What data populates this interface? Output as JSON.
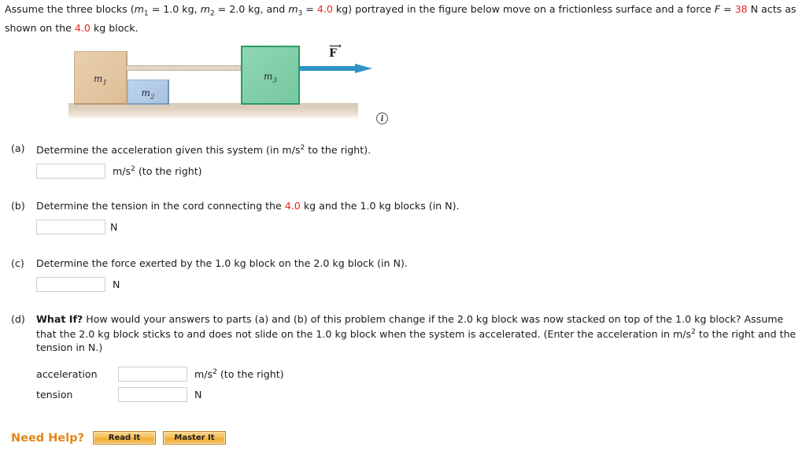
{
  "prompt": {
    "seg1": "Assume the three blocks (",
    "m1_sym": "m",
    "m1_sub": "1",
    "m1_eq": " = 1.0 kg, ",
    "m2_sym": "m",
    "m2_sub": "2",
    "m2_eq": " = 2.0 kg, and ",
    "m3_sym": "m",
    "m3_sub": "3",
    "m3_eq": " = ",
    "m3_val": "4.0",
    "seg2": " kg) portrayed in the figure below move on a frictionless surface and a force ",
    "f_sym": "F",
    "f_eq": " = ",
    "f_val": "38",
    "seg3": " N acts as shown on the ",
    "block_val": "4.0",
    "seg4": " kg block."
  },
  "figure": {
    "block_m1_label": "m",
    "block_m1_sub": "1",
    "block_m2_label": "m",
    "block_m2_sub": "2",
    "block_m3_label": "m",
    "block_m3_sub": "3",
    "force_label": "F",
    "force_vector_bar": "⟶",
    "info_icon_glyph": "i",
    "colors": {
      "block_m1": "#e3c6a2",
      "block_m2": "#b2cbe6",
      "block_m3": "#81ceaa",
      "block_m3_border": "#2a9b63",
      "arrow": "#2f93c8",
      "ground": "#ded0bd",
      "cord": "#cdbba4"
    }
  },
  "parts": {
    "a": {
      "tag": "(a)",
      "text_pre": "Determine the acceleration given this system (in m/s",
      "text_sup": "2",
      "text_post": " to the right).",
      "input_value": "",
      "input_placeholder": "",
      "unit_pre": "m/s",
      "unit_sup": "2",
      "unit_post": " (to the right)"
    },
    "b": {
      "tag": "(b)",
      "text_pre": "Determine the tension in the cord connecting the ",
      "text_red": "4.0",
      "text_post": " kg and the 1.0 kg blocks (in N).",
      "input_value": "",
      "input_placeholder": "",
      "unit": "N"
    },
    "c": {
      "tag": "(c)",
      "text": "Determine the force exerted by the 1.0 kg block on the 2.0 kg block (in N).",
      "input_value": "",
      "input_placeholder": "",
      "unit": "N"
    },
    "d": {
      "tag": "(d)",
      "what_if": "What If?",
      "text_pre": " How would your answers to parts (a) and (b) of this problem change if the 2.0 kg block was now stacked on top of the 1.0 kg block? Assume that the 2.0 kg block sticks to and does not slide on the 1.0 kg block when the system is accelerated. (Enter the acceleration in m/s",
      "text_sup": "2",
      "text_post": " to the right and the tension in N.)",
      "acceleration_label": "acceleration",
      "acceleration_value": "",
      "acceleration_placeholder": "",
      "acceleration_unit_pre": "m/s",
      "acceleration_unit_sup": "2",
      "acceleration_unit_post": " (to the right)",
      "tension_label": "tension",
      "tension_value": "",
      "tension_placeholder": "",
      "tension_unit": "N"
    }
  },
  "need_help": {
    "label": "Need Help?",
    "read_it": "Read It",
    "master_it": "Master It",
    "accent_color": "#e2861b"
  }
}
